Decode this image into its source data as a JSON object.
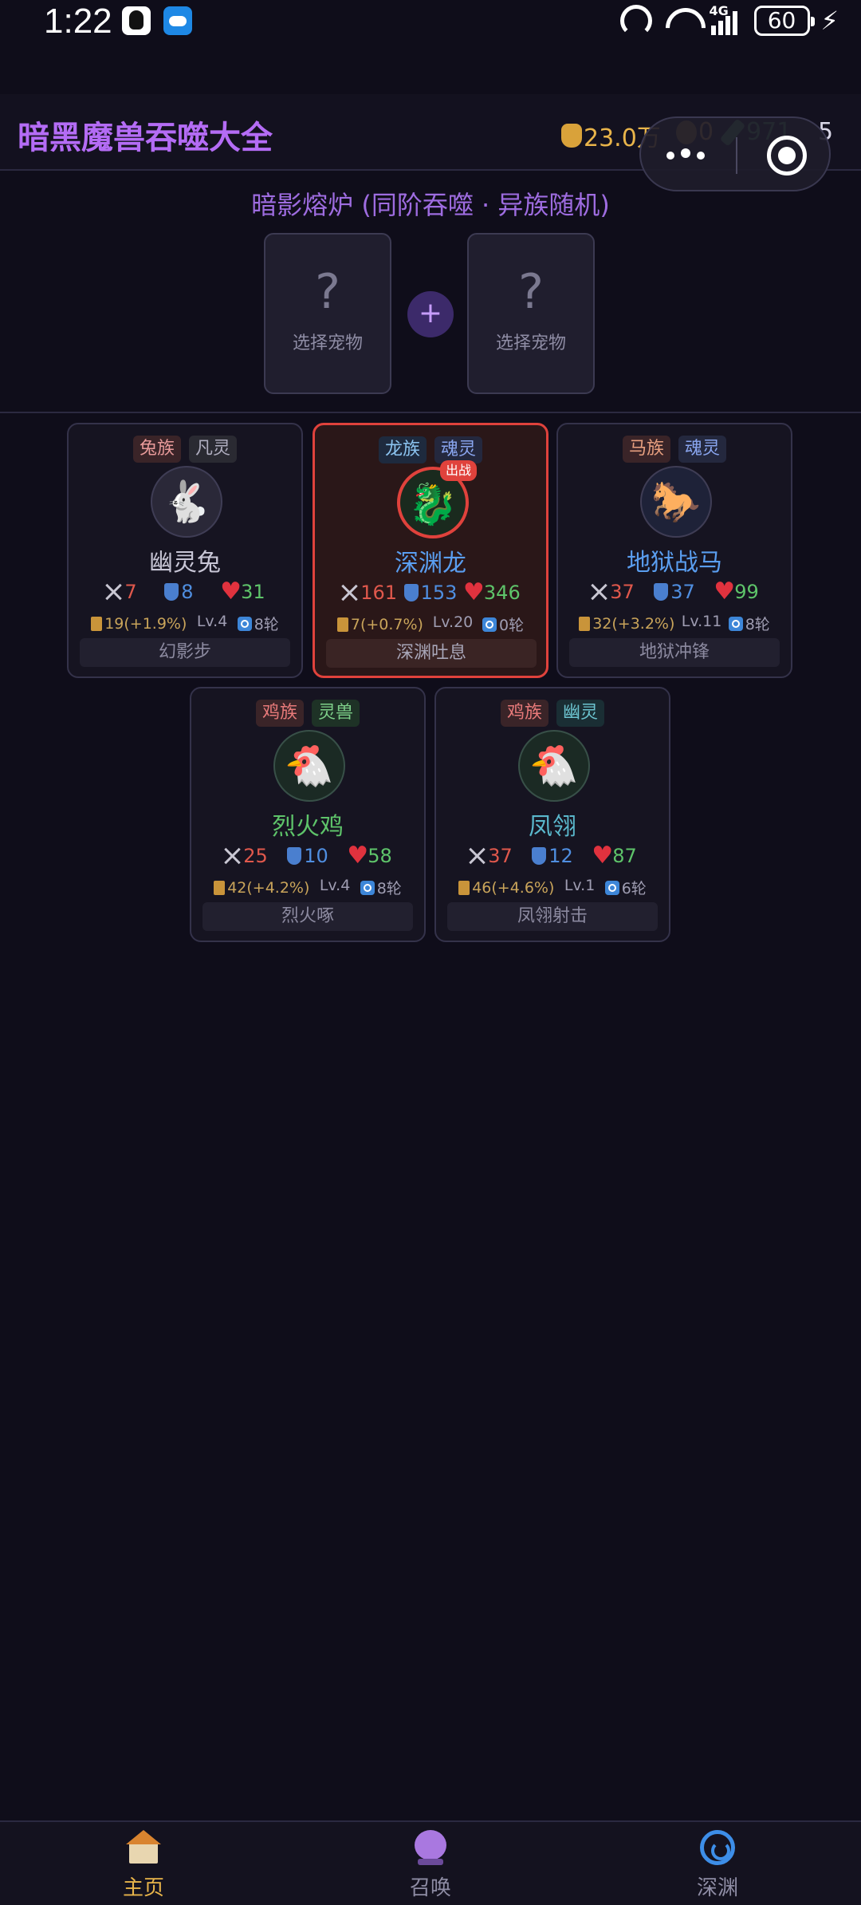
{
  "status_bar": {
    "time": "1:22",
    "network": "4G",
    "battery": "60"
  },
  "header": {
    "title": "暗黑魔兽吞噬大全",
    "gold": "23.0万",
    "medals": "0",
    "gems": "971",
    "extra": "5"
  },
  "fusion": {
    "title": "暗影熔炉 (同阶吞噬 · 异族随机)",
    "slot_left": {
      "symbol": "?",
      "label": "选择宠物"
    },
    "slot_right": {
      "symbol": "?",
      "label": "选择宠物"
    },
    "plus": "+"
  },
  "pets": [
    {
      "tags": [
        "兔族",
        "凡灵"
      ],
      "name": "幽灵兔",
      "avatar": "🐇",
      "atk": "7",
      "def": "8",
      "hp": "31",
      "xp": "19(+1.9%)",
      "level": "Lv.4",
      "rounds": "8轮",
      "skill": "幻影步",
      "active": false
    },
    {
      "tags": [
        "龙族",
        "魂灵"
      ],
      "name": "深渊龙",
      "avatar": "🐉",
      "badge": "出战",
      "atk": "161",
      "def": "153",
      "hp": "346",
      "xp": "7(+0.7%)",
      "level": "Lv.20",
      "rounds": "0轮",
      "skill": "深渊吐息",
      "active": true
    },
    {
      "tags": [
        "马族",
        "魂灵"
      ],
      "name": "地狱战马",
      "avatar": "🐎",
      "atk": "37",
      "def": "37",
      "hp": "99",
      "xp": "32(+3.2%)",
      "level": "Lv.11",
      "rounds": "8轮",
      "skill": "地狱冲锋",
      "active": false
    },
    {
      "tags": [
        "鸡族",
        "灵兽"
      ],
      "name": "烈火鸡",
      "avatar": "🐔",
      "atk": "25",
      "def": "10",
      "hp": "58",
      "xp": "42(+4.2%)",
      "level": "Lv.4",
      "rounds": "8轮",
      "skill": "烈火啄",
      "active": false
    },
    {
      "tags": [
        "鸡族",
        "幽灵"
      ],
      "name": "凤翎",
      "avatar": "🐔",
      "atk": "37",
      "def": "12",
      "hp": "87",
      "xp": "46(+4.6%)",
      "level": "Lv.1",
      "rounds": "6轮",
      "skill": "凤翎射击",
      "active": false
    }
  ],
  "nav": {
    "home": "主页",
    "summon": "召唤",
    "abyss": "深渊"
  },
  "colors": {
    "background": "#0f0d1a",
    "title_purple": "#b46cf5",
    "active_border": "#e0423c",
    "gold": "#e8b44a"
  }
}
